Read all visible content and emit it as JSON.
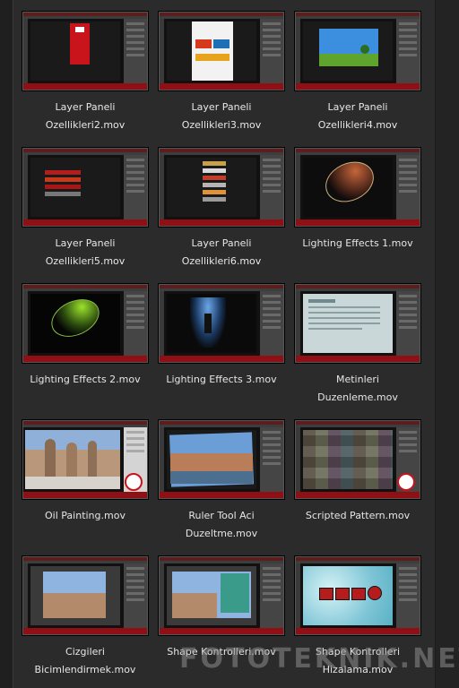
{
  "videos": [
    {
      "line1": "Layer Paneli",
      "line2": "Ozellikleri2.mov",
      "thumb": "red-banner"
    },
    {
      "line1": "Layer Paneli",
      "line2": "Ozellikleri3.mov",
      "thumb": "white-ads"
    },
    {
      "line1": "Layer Paneli",
      "line2": "Ozellikleri4.mov",
      "thumb": "sky-field"
    },
    {
      "line1": "Layer Paneli",
      "line2": "Ozellikleri5.mov",
      "thumb": "dark-text"
    },
    {
      "line1": "Layer Paneli",
      "line2": "Ozellikleri6.mov",
      "thumb": "dark-text"
    },
    {
      "line1": "Lighting Effects 1.mov",
      "line2": "",
      "thumb": "light-orange"
    },
    {
      "line1": "Lighting Effects 2.mov",
      "line2": "",
      "thumb": "light-green"
    },
    {
      "line1": "Lighting Effects 3.mov",
      "line2": "",
      "thumb": "light-blue"
    },
    {
      "line1": "Metinleri",
      "line2": "Duzenleme.mov",
      "thumb": "text-doc"
    },
    {
      "line1": "Oil Painting.mov",
      "line2": "",
      "thumb": "rocks"
    },
    {
      "line1": "Ruler Tool Aci",
      "line2": "Duzeltme.mov",
      "thumb": "city"
    },
    {
      "line1": "Scripted Pattern.mov",
      "line2": "",
      "thumb": "pattern"
    },
    {
      "line1": "Cizgileri",
      "line2": "Bicimlendirmek.mov",
      "thumb": "rocks-sky"
    },
    {
      "line1": "Shape Kontrolleri.mov",
      "line2": "",
      "thumb": "rocks-text"
    },
    {
      "line1": "Shape Kontrolleri",
      "line2": "Hizalama.mov",
      "thumb": "shapes"
    }
  ],
  "watermark": "FOTOTEKNIK.NET",
  "colors": {
    "background": "#2b2b2b",
    "label": "#e6e6e6",
    "accent_red": "#8e0f14"
  }
}
